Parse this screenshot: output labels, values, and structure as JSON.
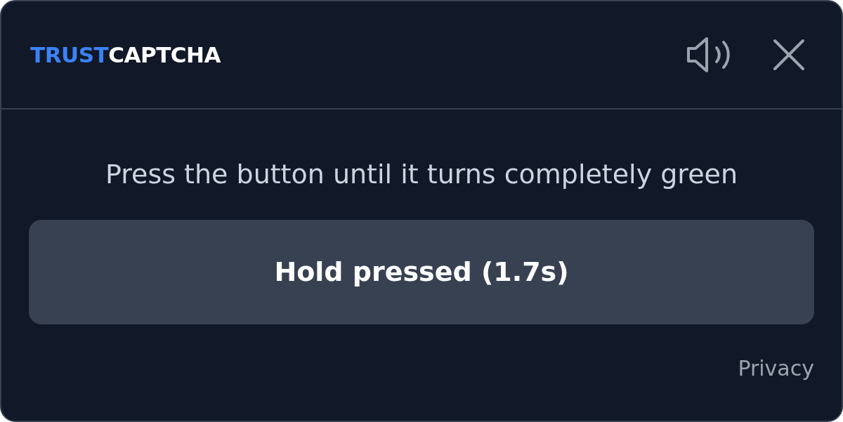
{
  "logo": {
    "parts": [
      "TRUST",
      "CAPTCHA"
    ]
  },
  "instruction": "Press the button until it turns completely green",
  "hold_button": {
    "label": "Hold pressed (1.7s)"
  },
  "footer_link": "Privacy"
}
